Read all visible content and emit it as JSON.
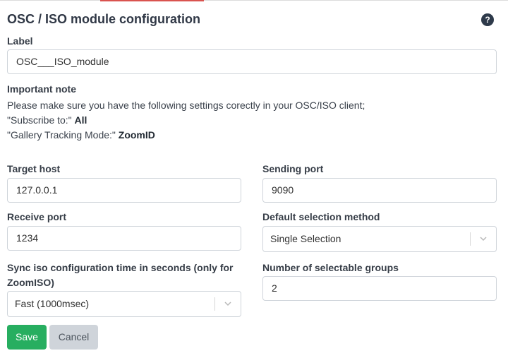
{
  "page": {
    "title": "OSC / ISO module configuration",
    "help_icon": "?"
  },
  "form": {
    "label_label": "Label",
    "label_value": "OSC___ISO_module",
    "note_heading": "Important note",
    "note_line1": "Please make sure you have the following settings corectly in your OSC/ISO client;",
    "note_line2_prefix": "\"Subscribe to:\"",
    "note_line2_value": "All",
    "note_line3_prefix": "\"Gallery Tracking Mode:\"",
    "note_line3_value": "ZoomID",
    "target_host_label": "Target host",
    "target_host_value": "127.0.0.1",
    "sending_port_label": "Sending port",
    "sending_port_value": "9090",
    "receive_port_label": "Receive port",
    "receive_port_value": "1234",
    "default_selection_label": "Default selection method",
    "default_selection_value": "Single Selection",
    "sync_label_line1": "Sync iso configuration time in seconds (only for",
    "sync_label_line2": "ZoomISO)",
    "sync_value": "Fast (1000msec)",
    "groups_label": "Number of selectable groups",
    "groups_value": "2"
  },
  "buttons": {
    "save": "Save",
    "cancel": "Cancel"
  },
  "colors": {
    "save_bg": "#27ae60",
    "cancel_bg": "#cfd4da",
    "accent": "#d9534f"
  }
}
